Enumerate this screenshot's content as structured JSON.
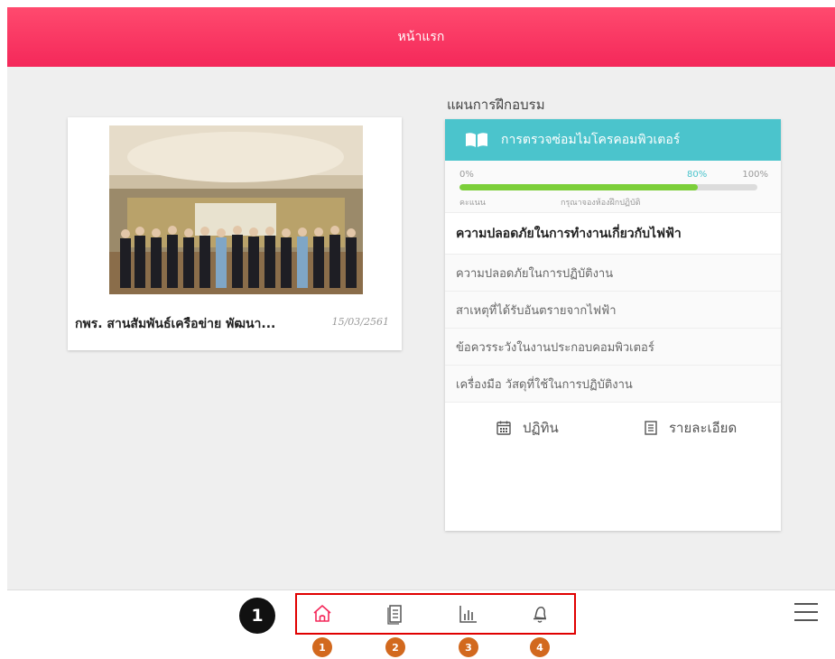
{
  "header": {
    "title": "หน้าแรก"
  },
  "news": {
    "title": "กพร. สานสัมพันธ์เครือข่าย พัฒนา...",
    "date": "15/03/2561"
  },
  "training": {
    "heading": "แผนการฝึกอบรม",
    "course_title": "การตรวจซ่อมไมโครคอมพิวเตอร์",
    "progress": {
      "min_label": "0%",
      "current_label": "80%",
      "max_label": "100%",
      "value": 0.8,
      "score_label": "คะแนน",
      "note": "กรุณาจองห้องฝึกปฏิบัติ"
    },
    "active_topic": "ความปลอดภัยในการทำงานเกี่ยวกับไฟฟ้า",
    "topics": [
      "ความปลอดภัยในการปฏิบัติงาน",
      "สาเหตุที่ได้รับอันตรายจากไฟฟ้า",
      "ข้อควรระวังในงานประกอบคอมพิวเตอร์",
      "เครื่องมือ วัสดุที่ใช้ในการปฏิบัติงาน"
    ],
    "actions": {
      "calendar": "ปฏิทิน",
      "details": "รายละเอียด"
    }
  },
  "bottom_nav": {
    "step_marker": "1",
    "items": [
      {
        "icon": "home-icon",
        "badge": "1",
        "active": true
      },
      {
        "icon": "document-icon",
        "badge": "2"
      },
      {
        "icon": "bar-chart-icon",
        "badge": "3"
      },
      {
        "icon": "bell-icon",
        "badge": "4"
      }
    ],
    "menu_icon": "hamburger-menu-icon"
  },
  "colors": {
    "header": "#f4285a",
    "teal": "#4bc4cc",
    "progress": "#7ccf3a",
    "badge": "#d2691e",
    "highlight": "#e00000"
  }
}
